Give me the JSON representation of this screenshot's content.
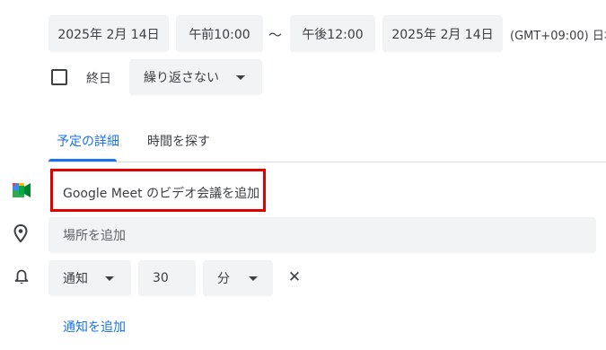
{
  "datetime": {
    "start_date": "2025年 2月 14日",
    "start_time": "午前10:00",
    "separator": "～",
    "end_time": "午後12:00",
    "end_date": "2025年 2月 14日",
    "timezone": "(GMT+09:00) 日本"
  },
  "allday": {
    "checked": false,
    "label": "終日"
  },
  "repeat": {
    "value": "繰り返さない"
  },
  "tabs": [
    {
      "label": "予定の詳細",
      "active": true
    },
    {
      "label": "時間を探す",
      "active": false
    }
  ],
  "meet": {
    "label": "Google Meet のビデオ会議を追加",
    "highlight_color": "#e00000"
  },
  "location": {
    "placeholder": "場所を追加"
  },
  "notification": {
    "type": "通知",
    "amount": "30",
    "unit": "分",
    "remove_glyph": "✕"
  },
  "add_notification": {
    "label": "通知を追加"
  },
  "colors": {
    "accent": "#1a73e8",
    "link": "#1a73e8",
    "chip_bg": "#f1f3f4",
    "text": "#3c4043",
    "divider": "#dadce0"
  }
}
